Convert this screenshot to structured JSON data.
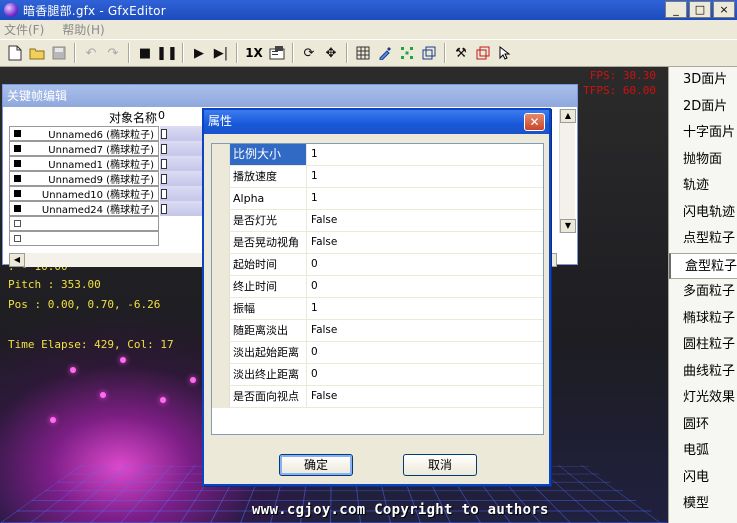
{
  "window": {
    "title": "暗香腿部.gfx - GfxEditor"
  },
  "menu": [
    "文件(F)",
    "帮助(H)"
  ],
  "toolbar": {
    "speed_label": "1X"
  },
  "hud": {
    "fps": "FPS: 30.30",
    "tfps": "TFPS: 60.00",
    "partial_line": "    : - 10.00",
    "pitch": "Pitch : 353.00",
    "pos": "Pos   : 0.00, 0.70, -6.26",
    "time": "Time Elapse: 429, Col: 17"
  },
  "watermark": "www.cgjoy.com Copyright to authors",
  "keyframe_editor": {
    "title": "关键帧编辑",
    "column_header": "对象名称",
    "frame_zero": "0",
    "rows": [
      "Unnamed6 (椭球粒子)",
      "Unnamed7 (椭球粒子)",
      "Unnamed1 (椭球粒子)",
      "Unnamed9 (椭球粒子)",
      "Unnamed10 (椭球粒子)",
      "Unnamed24 (椭球粒子)"
    ]
  },
  "dialog": {
    "title": "属性",
    "properties": [
      {
        "name": "比例大小",
        "value": "1"
      },
      {
        "name": "播放速度",
        "value": "1"
      },
      {
        "name": "Alpha",
        "value": "1"
      },
      {
        "name": "是否灯光",
        "value": "False"
      },
      {
        "name": "是否晃动视角",
        "value": "False"
      },
      {
        "name": "起始时间",
        "value": "0"
      },
      {
        "name": "终止时间",
        "value": "0"
      },
      {
        "name": "振幅",
        "value": "1"
      },
      {
        "name": "随距离淡出",
        "value": "False"
      },
      {
        "name": "淡出起始距离",
        "value": "0"
      },
      {
        "name": "淡出终止距离",
        "value": "0"
      },
      {
        "name": "是否面向视点",
        "value": "False"
      }
    ],
    "ok_label": "确定",
    "cancel_label": "取消"
  },
  "object_panel": {
    "items": [
      "3D面片",
      "2D面片",
      "十字面片",
      "抛物面",
      "轨迹",
      "闪电轨迹",
      "点型粒子",
      "盒型粒子",
      "多面粒子",
      "椭球粒子",
      "圆柱粒子",
      "曲线粒子",
      "灯光效果",
      "圆环",
      "电弧",
      "闪电",
      "模型"
    ],
    "selected_index": 7
  }
}
